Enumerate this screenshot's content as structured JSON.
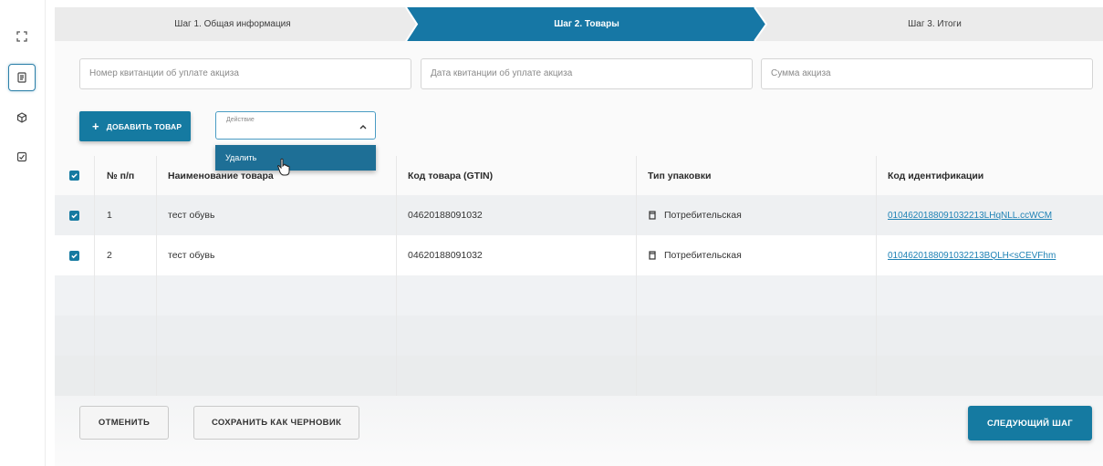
{
  "colors": {
    "accent": "#157aa1",
    "active_step": "#1677a5",
    "link": "#1f82b5",
    "dropdown_bg": "#1e6f96"
  },
  "rail": {
    "icons": [
      "expand-icon",
      "document-icon",
      "cube-icon",
      "checklist-icon"
    ]
  },
  "stepper": {
    "steps": [
      {
        "label": "Шаг 1. Общая информация",
        "state": "done"
      },
      {
        "label": "Шаг 2. Товары",
        "state": "active"
      },
      {
        "label": "Шаг 3. Итоги",
        "state": "pending"
      }
    ]
  },
  "fields": {
    "receipt_number_placeholder": "Номер квитанции об уплате акциза",
    "receipt_date_placeholder": "Дата квитанции об уплате акциза",
    "excise_amount_placeholder": "Сумма акциза"
  },
  "toolbar": {
    "add_item_label": "ДОБАВИТЬ ТОВАР",
    "action_label": "Действие",
    "action_options": [
      "Удалить"
    ]
  },
  "table": {
    "columns": [
      "№ п/п",
      "Наименование товара",
      "Код товара (GTIN)",
      "Тип упаковки",
      "Код идентификации"
    ],
    "rows": [
      {
        "num": "1",
        "name": "тест обувь",
        "gtin": "04620188091032",
        "package": "Потребительская",
        "code": "0104620188091032213LHqNLL.ccWCM",
        "checked": true
      },
      {
        "num": "2",
        "name": "тест обувь",
        "gtin": "04620188091032",
        "package": "Потребительская",
        "code": "0104620188091032213BQLH<sCEVFhm",
        "checked": true
      }
    ]
  },
  "footer": {
    "cancel_label": "ОТМЕНИТЬ",
    "save_draft_label": "СОХРАНИТЬ КАК ЧЕРНОВИК",
    "next_step_label": "СЛЕДУЮЩИЙ ШАГ"
  }
}
